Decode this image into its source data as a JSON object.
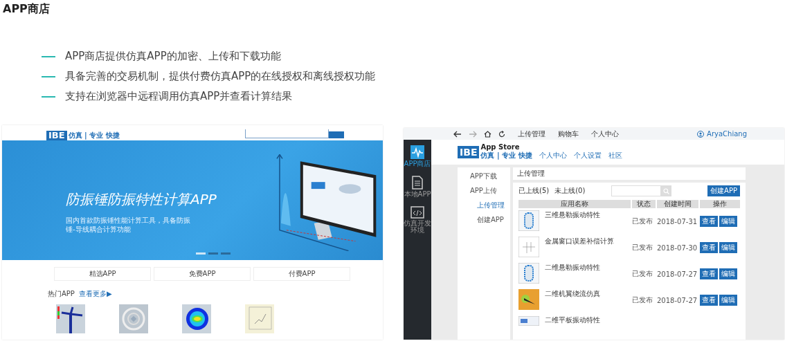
{
  "title": "APP商店",
  "features": [
    "APP商店提供仿真APP的加密、上传和下载功能",
    "具备完善的交易机制，提供付费仿真APP的在线授权和离线授权功能",
    "支持在浏览器中远程调用仿真APP并查看计算结果"
  ],
  "store_home": {
    "logo": {
      "mark": "IBE",
      "tagline": "仿真 | 专业 快捷"
    },
    "banner": {
      "title": "防振锤防振特性计算APP",
      "subtitle": "国内首款防振锤性能计算工具，具备防振锤-导线耦合计算功能",
      "slides": [
        {
          "selected": true
        },
        {
          "selected": false
        },
        {
          "selected": false
        }
      ]
    },
    "categories": [
      "精选APP",
      "免费APP",
      "付费APP"
    ],
    "hot": {
      "heading": "热门APP",
      "more": "查看更多▶"
    },
    "hot_apps": [
      {
        "kind": "turbine"
      },
      {
        "kind": "ring"
      },
      {
        "kind": "heatmap"
      },
      {
        "kind": "plot"
      }
    ]
  },
  "upload_manager": {
    "nav": [
      "上传管理",
      "购物车",
      "个人中心"
    ],
    "user": "AryaChiang",
    "sidebar": [
      {
        "label": "APP商店",
        "kind": "store",
        "selected": true
      },
      {
        "label": "本地APP",
        "kind": "document",
        "selected": false
      },
      {
        "label": "仿真开发环境",
        "kind": "code",
        "selected": false
      }
    ],
    "logo": {
      "mark": "IBE",
      "name": "App Store",
      "tagline": "仿真 | 专业 快捷"
    },
    "links": [
      "个人中心",
      "个人设置",
      "社区"
    ],
    "menu": [
      {
        "label": "APP下载",
        "selected": false
      },
      {
        "label": "APP上传",
        "selected": false,
        "children": [
          {
            "label": "上传管理",
            "selected": true
          },
          {
            "label": "创建APP",
            "selected": false
          }
        ]
      }
    ],
    "panel_title": "上传管理",
    "filters": [
      "已上线(5)",
      "未上线(0)"
    ],
    "create_button": "创建APP",
    "columns": [
      "应用名称",
      "状态",
      "创建时间",
      "操作"
    ],
    "rows": [
      {
        "kind": "vessel",
        "name": "三维悬勒振动特性",
        "status": "已发布",
        "date": "2018-07-31",
        "actions": [
          "查看",
          "编辑"
        ]
      },
      {
        "kind": "sketch",
        "name": "金属窗口误差补偿计算",
        "status": "已发布",
        "date": "2018-07-30",
        "actions": [
          "查看",
          "编辑"
        ]
      },
      {
        "kind": "vessel",
        "name": "二维悬勒振动特性",
        "status": "已发布",
        "date": "2018-07-27",
        "actions": [
          "查看",
          "编辑"
        ]
      },
      {
        "kind": "airfoil",
        "name": "二维机翼绕流仿真",
        "status": "已发布",
        "date": "2018-07-27",
        "actions": [
          "查看",
          "编辑"
        ]
      },
      {
        "kind": "plate",
        "name": "二维平板振动特性"
      }
    ]
  }
}
